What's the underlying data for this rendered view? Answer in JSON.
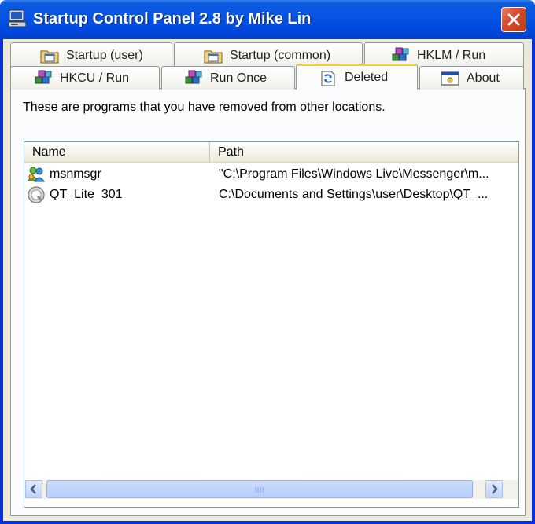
{
  "window": {
    "title": "Startup Control Panel 2.8 by Mike Lin",
    "icon": "computer-icon",
    "close_icon": "close-x-icon"
  },
  "tabs": {
    "row1": [
      {
        "label": "Startup (user)",
        "icon": "folder-startup-icon"
      },
      {
        "label": "Startup (common)",
        "icon": "folder-startup-icon"
      },
      {
        "label": "HKLM / Run",
        "icon": "registry-cubes-icon"
      }
    ],
    "row2": [
      {
        "label": "HKCU / Run",
        "icon": "registry-cubes-icon"
      },
      {
        "label": "Run Once",
        "icon": "registry-cubes-icon"
      },
      {
        "label": "Deleted",
        "icon": "recycle-icon",
        "active": true
      },
      {
        "label": "About",
        "icon": "window-info-icon"
      }
    ]
  },
  "panel": {
    "description": "These are programs that you have removed from other locations."
  },
  "list": {
    "columns": [
      "Name",
      "Path"
    ],
    "rows": [
      {
        "name": "msnmsgr",
        "path": "\"C:\\Program Files\\Windows Live\\Messenger\\m...",
        "icon": "messenger-buddies-icon"
      },
      {
        "name": "QT_Lite_301",
        "path": "C:\\Documents and Settings\\user\\Desktop\\QT_...",
        "icon": "quicktime-icon"
      }
    ]
  },
  "scrollbar": {
    "left_icon": "arrow-left-icon",
    "right_icon": "arrow-right-icon"
  }
}
